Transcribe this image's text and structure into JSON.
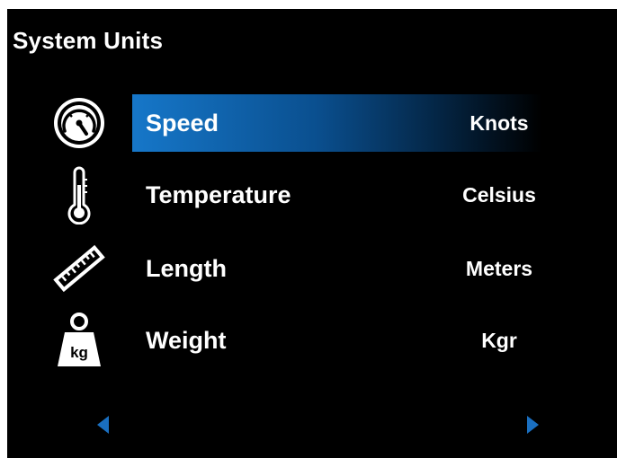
{
  "screen": {
    "title": "System Units"
  },
  "units": [
    {
      "icon": "speedometer-icon",
      "label": "Speed",
      "value": "Knots",
      "selected": true
    },
    {
      "icon": "thermometer-icon",
      "label": "Temperature",
      "value": "Celsius",
      "selected": false
    },
    {
      "icon": "ruler-icon",
      "label": "Length",
      "value": "Meters",
      "selected": false
    },
    {
      "icon": "weight-kg-icon",
      "label": "Weight",
      "value": "Kgr",
      "selected": false
    }
  ],
  "weight_icon_text": "kg",
  "navigation": {
    "prev_icon": "arrow-left-icon",
    "next_icon": "arrow-right-icon"
  },
  "colors": {
    "background": "#000000",
    "text": "#ffffff",
    "highlight": "#1677c9",
    "nav_arrow": "#1a6fc0"
  }
}
